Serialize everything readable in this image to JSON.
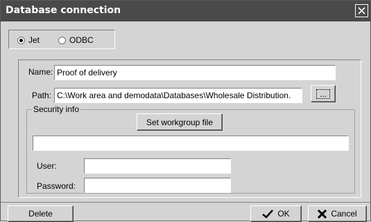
{
  "window": {
    "title": "Database connection"
  },
  "connection_type": {
    "options": [
      {
        "label": "Jet",
        "checked": true
      },
      {
        "label": "ODBC",
        "checked": false
      }
    ]
  },
  "form": {
    "name_label": "Name:",
    "name_value": "Proof of delivery",
    "path_label": "Path:",
    "path_value": "C:\\Work area and demodata\\Databases\\Wholesale Distribution.",
    "browse_label": "...",
    "security": {
      "group_label": "Security info",
      "workgroup_button": "Set workgroup file",
      "workgroup_value": "",
      "user_label": "User:",
      "user_value": "",
      "password_label": "Password:",
      "password_value": ""
    }
  },
  "footer": {
    "delete_label": "Delete",
    "ok_label": "OK",
    "cancel_label": "Cancel"
  },
  "colors": {
    "titlebar": "#4a4a4a",
    "dialog_bg": "#d4d4d4"
  }
}
